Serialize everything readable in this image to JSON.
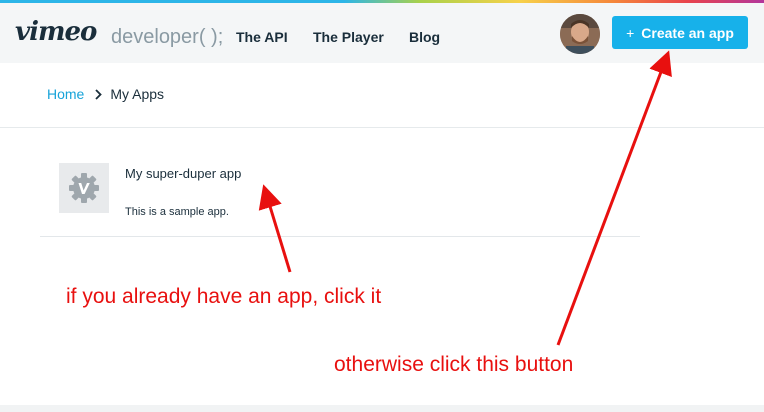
{
  "header": {
    "logo_text": "vimeo",
    "developer_text": "developer( );",
    "nav": [
      {
        "label": "The API"
      },
      {
        "label": "The Player"
      },
      {
        "label": "Blog"
      }
    ],
    "create_button": {
      "icon": "+",
      "label": "Create an app",
      "color": "#17b1ea"
    }
  },
  "breadcrumb": {
    "home": "Home",
    "current": "My Apps"
  },
  "apps": [
    {
      "title": "My super-duper app",
      "description": "This is a sample app.",
      "icon": "vimeo-gear-icon"
    }
  ],
  "annotations": {
    "existing_app": "if you already have an app, click it",
    "create_button": "otherwise click this button",
    "color": "#e8100f"
  }
}
